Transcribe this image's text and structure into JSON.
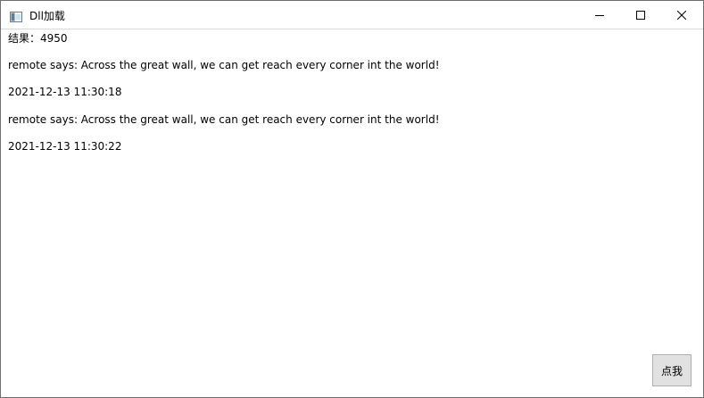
{
  "window": {
    "title": "Dll加载",
    "app_icon": "window-app-icon",
    "controls": {
      "minimize": "minimize-icon",
      "maximize": "maximize-icon",
      "close": "close-icon"
    }
  },
  "content": {
    "lines": [
      "结果：4950",
      "remote says: Across the great wall, we can get reach every corner int the world!",
      "2021-12-13 11:30:18",
      "remote says: Across the great wall, we can get reach every corner int the world!",
      "2021-12-13 11:30:22"
    ]
  },
  "button": {
    "label": "点我"
  }
}
